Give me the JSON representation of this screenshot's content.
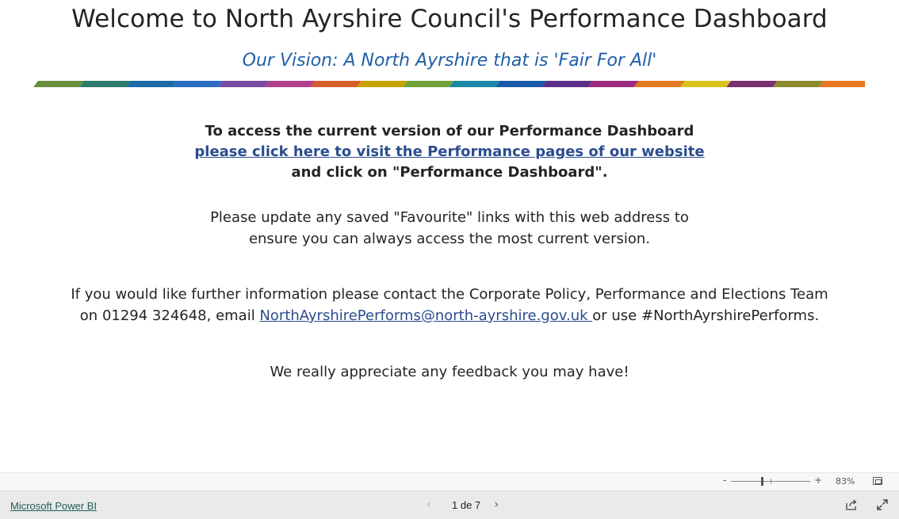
{
  "report": {
    "title": "Welcome to North Ayrshire Council's Performance Dashboard",
    "vision": "Our Vision:  A North Ayrshire that is 'Fair For All'",
    "stripe_colors": [
      "#6a8f3c",
      "#2e7a6e",
      "#1c6ba6",
      "#2b6ec1",
      "#7a4aa0",
      "#b0418c",
      "#d65e2b",
      "#c9a400",
      "#6fa33a",
      "#1e87a6",
      "#1a5aa8",
      "#5b2f88",
      "#9c2c7e",
      "#e07a1f",
      "#d9c21b",
      "#7a2f6e",
      "#8b8b2d",
      "#e87820"
    ],
    "access": {
      "line1": "To access the current version of our Performance Dashboard",
      "link": "please click here to visit the Performance pages of our website",
      "line3": "and click on \"Performance Dashboard\"."
    },
    "update": {
      "line1": "Please update any saved \"Favourite\" links with this web address to",
      "line2": "ensure you can always access the most current version."
    },
    "contact": {
      "line1": "If you would like further information please contact the Corporate Policy, Performance and Elections Team",
      "line2_prefix": "on 01294 324648, email ",
      "email": "NorthAyrshirePerforms@north-ayrshire.gov.uk ",
      "line2_suffix": "or use #NorthAyrshirePerforms."
    },
    "feedback": "We really appreciate any feedback you may have!"
  },
  "zoom": {
    "minus_label": "-",
    "plus_label": "+",
    "level": "83%"
  },
  "footer": {
    "brand": "Microsoft Power BI",
    "page_label": "1 de 7",
    "prev_glyph": "‹",
    "next_glyph": "›"
  }
}
